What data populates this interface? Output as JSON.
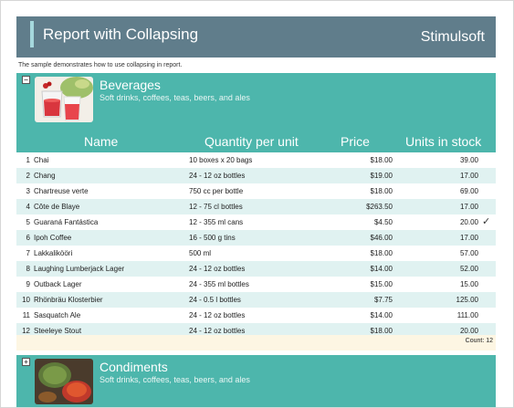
{
  "header": {
    "title": "Report with Collapsing",
    "brand": "Stimulsoft"
  },
  "description": "The sample demonstrates how to use collapsing in report.",
  "categories": [
    {
      "name": "Beverages",
      "subtitle": "Soft drinks, coffees, teas, beers, and ales",
      "toggle": "−"
    },
    {
      "name": "Condiments",
      "subtitle": "Soft drinks, coffees, teas, beers, and ales",
      "toggle": "+"
    }
  ],
  "columns": {
    "name": "Name",
    "quantity": "Quantity per unit",
    "price": "Price",
    "stock": "Units in stock"
  },
  "rows": [
    {
      "n": "1",
      "name": "Chai",
      "qty": "10 boxes x 20 bags",
      "price": "$18.00",
      "stock": "39.00"
    },
    {
      "n": "2",
      "name": "Chang",
      "qty": "24 - 12 oz bottles",
      "price": "$19.00",
      "stock": "17.00"
    },
    {
      "n": "3",
      "name": "Chartreuse verte",
      "qty": "750 cc per bottle",
      "price": "$18.00",
      "stock": "69.00"
    },
    {
      "n": "4",
      "name": "Côte de Blaye",
      "qty": "12 - 75 cl bottles",
      "price": "$263.50",
      "stock": "17.00"
    },
    {
      "n": "5",
      "name": "Guaraná Fantástica",
      "qty": "12 - 355 ml cans",
      "price": "$4.50",
      "stock": "20.00"
    },
    {
      "n": "6",
      "name": "Ipoh Coffee",
      "qty": "16 - 500 g tins",
      "price": "$46.00",
      "stock": "17.00"
    },
    {
      "n": "7",
      "name": "Lakkalikööri",
      "qty": "500 ml",
      "price": "$18.00",
      "stock": "57.00"
    },
    {
      "n": "8",
      "name": "Laughing Lumberjack Lager",
      "qty": "24 - 12 oz bottles",
      "price": "$14.00",
      "stock": "52.00"
    },
    {
      "n": "9",
      "name": "Outback Lager",
      "qty": "24 - 355 ml bottles",
      "price": "$15.00",
      "stock": "15.00"
    },
    {
      "n": "10",
      "name": "Rhönbräu Klosterbier",
      "qty": "24 - 0.5 l bottles",
      "price": "$7.75",
      "stock": "125.00"
    },
    {
      "n": "11",
      "name": "Sasquatch Ale",
      "qty": "24 - 12 oz bottles",
      "price": "$14.00",
      "stock": "111.00"
    },
    {
      "n": "12",
      "name": "Steeleye Stout",
      "qty": "24 - 12 oz bottles",
      "price": "$18.00",
      "stock": "20.00"
    }
  ],
  "footer": {
    "count": "Count: 12"
  },
  "icons": {
    "check": "checkmark-icon"
  },
  "colors": {
    "header": "#607d8b",
    "accent": "#4db6ac",
    "row_alt": "#e0f2f1",
    "footer": "#fdf6e3"
  }
}
